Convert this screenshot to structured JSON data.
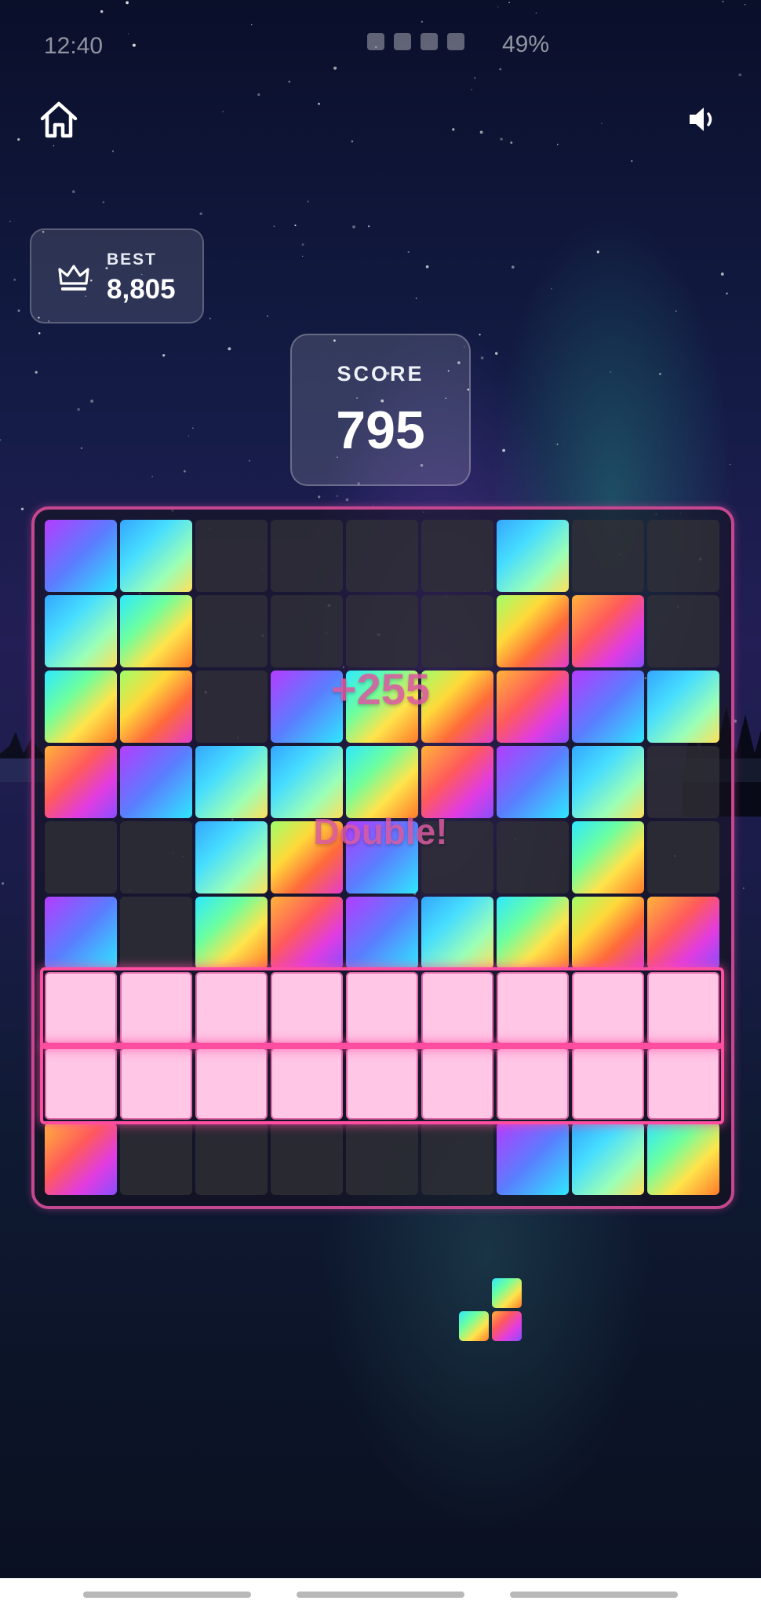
{
  "status_bar": {
    "time": "12:40",
    "battery": "49%"
  },
  "header": {
    "home_icon": "home-icon",
    "sound_icon": "speaker-icon"
  },
  "best": {
    "label": "BEST",
    "value": "8,805",
    "icon": "crown-icon"
  },
  "score": {
    "label": "SCORE",
    "value": "795"
  },
  "floating_text": {
    "points": "+255",
    "combo": "Double!"
  },
  "board": {
    "rows": 9,
    "cols": 9,
    "cells": [
      [
        "g1",
        "g2",
        "empty",
        "empty",
        "empty",
        "empty",
        "g2",
        "empty",
        "empty"
      ],
      [
        "g2",
        "g3",
        "empty",
        "empty",
        "empty",
        "empty",
        "g4",
        "g5",
        "empty"
      ],
      [
        "g3",
        "g4",
        "empty",
        "g1",
        "g3",
        "g4",
        "g5",
        "g1",
        "g2"
      ],
      [
        "g5",
        "g1",
        "g2",
        "g2",
        "g3",
        "g5",
        "g1",
        "g2",
        "empty"
      ],
      [
        "empty",
        "empty",
        "g2",
        "g4",
        "g1",
        "empty",
        "empty",
        "g3",
        "empty"
      ],
      [
        "g1",
        "empty",
        "g3",
        "g5",
        "g1",
        "g2",
        "g3",
        "g4",
        "g5"
      ],
      [
        "pink",
        "pink",
        "pink",
        "pink",
        "pink",
        "pink",
        "pink",
        "pink",
        "pink"
      ],
      [
        "pink",
        "pink",
        "pink",
        "pink",
        "pink",
        "pink",
        "pink",
        "pink",
        "pink"
      ],
      [
        "g5",
        "empty",
        "empty",
        "empty",
        "empty",
        "empty",
        "g1",
        "g2",
        "g3"
      ]
    ],
    "clearing_rows": [
      6,
      7
    ]
  },
  "next_piece": {
    "blocks": [
      [
        0,
        1,
        "g3"
      ],
      [
        1,
        0,
        "g3"
      ],
      [
        1,
        1,
        "g5"
      ]
    ]
  },
  "colors": {
    "board_border": "#c5478f",
    "clear_highlight": "#ffc6e6",
    "clear_glow": "#ff4ea2",
    "combo_text": "#d95aa0"
  }
}
